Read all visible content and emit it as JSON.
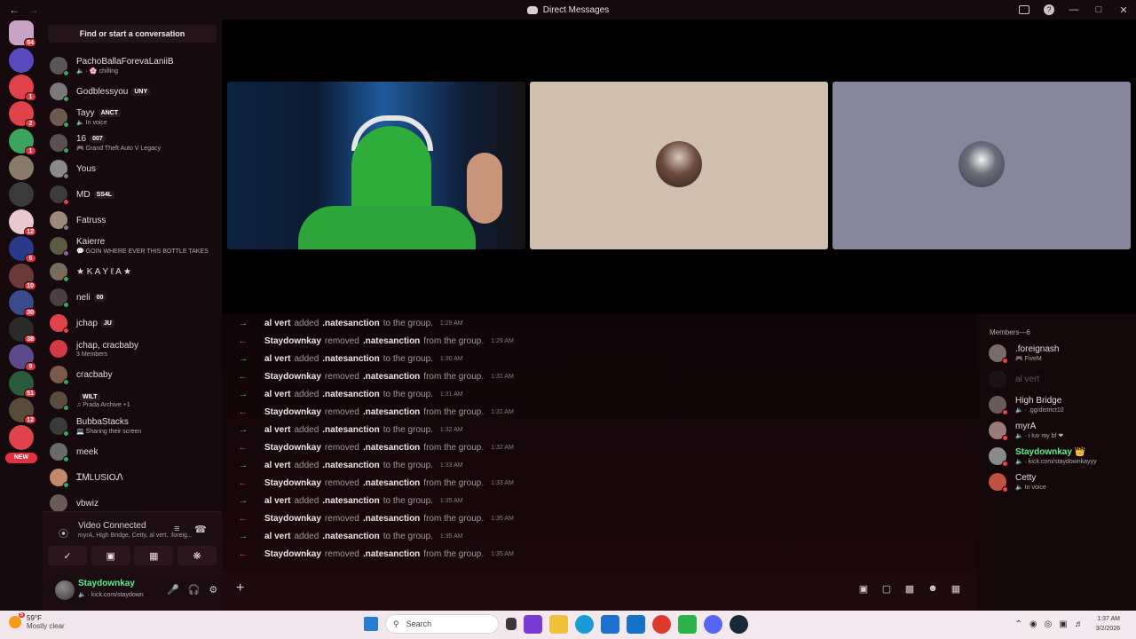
{
  "window": {
    "title": "Direct Messages"
  },
  "dm_panel": {
    "find_label": "Find or start a conversation",
    "items": [
      {
        "name": "PachoBallaForevaLaniiB",
        "sub": "🔈 · 🌸 chilling",
        "tag": "",
        "avatar": "#5b5656",
        "status": "#3ba55c"
      },
      {
        "name": "Godblessyou",
        "sub": "",
        "tag": "UNY",
        "avatar": "#7a7a7a",
        "status": "#3ba55c"
      },
      {
        "name": "Tayy",
        "sub": "🔈 In voice",
        "tag": "ANCT",
        "avatar": "#6b5a50",
        "status": "#3ba55c"
      },
      {
        "name": "16",
        "sub": "🎮 Grand Theft Auto V Legacy",
        "tag": "007",
        "avatar": "#5d5050",
        "status": "#3ba55c"
      },
      {
        "name": "Yous",
        "sub": "",
        "tag": "",
        "avatar": "#8a8a8a",
        "status": "#747f8d"
      },
      {
        "name": "MD",
        "sub": "",
        "tag": "SS4L",
        "avatar": "#3c3c3c",
        "status": "#ed4245"
      },
      {
        "name": "Fatruss",
        "sub": "",
        "tag": "",
        "avatar": "#9a8a7a",
        "status": "#747f8d"
      },
      {
        "name": "Kaierre",
        "sub": "💬 GOIN WHERE EVER THIS BOTTLE TAKES",
        "tag": "",
        "avatar": "#5c5a40",
        "status": "#9b59b6"
      },
      {
        "name": "★ K A Y ℓ A ★",
        "sub": "",
        "tag": "",
        "avatar": "#7a6a60",
        "status": "#3ba55c"
      },
      {
        "name": "neli",
        "sub": "",
        "tag": "00",
        "avatar": "#4a4040",
        "status": "#3ba55c"
      },
      {
        "name": "jchap",
        "sub": "",
        "tag": "JU",
        "avatar": "#e0424c",
        "status": "#ed4245"
      },
      {
        "name": "jchap, cracbaby",
        "sub": "3 Members",
        "tag": "",
        "avatar": "#d43a44",
        "status": ""
      },
      {
        "name": "cracbaby",
        "sub": "",
        "tag": "",
        "avatar": "#7a5a4a",
        "status": "#3ba55c"
      },
      {
        "name": "",
        "sub": "♫ Prada Archive +1",
        "tag": "WILT",
        "avatar": "#5a4a40",
        "status": "#3ba55c"
      },
      {
        "name": "BubbaStacks",
        "sub": "💻 Sharing their screen",
        "tag": "",
        "avatar": "#3a3a3a",
        "status": "#3ba55c"
      },
      {
        "name": "meek",
        "sub": "",
        "tag": "",
        "avatar": "#6a6a6a",
        "status": "#3ba55c"
      },
      {
        "name": "ᏆᎷLUSIOᏁ",
        "sub": "",
        "tag": "",
        "avatar": "#c08a6a",
        "status": "#3ba55c"
      },
      {
        "name": "vbwiz",
        "sub": "",
        "tag": "",
        "avatar": "#6a5a5a",
        "status": ""
      }
    ]
  },
  "guilds": {
    "badges": [
      "54",
      "",
      "1",
      "2",
      "1",
      "",
      "",
      "12",
      "6",
      "10",
      "30",
      "38",
      "9",
      "51",
      "12",
      ""
    ],
    "new_label": "NEW"
  },
  "voice": {
    "status": "Video Connected",
    "members": "myrA, High Bridge, Cetty, al vert, .foreig..."
  },
  "user": {
    "name": "Staydownkay",
    "status": "🔈 · kick.com/staydown"
  },
  "chat": {
    "messages": [
      {
        "dir": "in",
        "actor": "al vert",
        "verb": "added",
        "target": ".natesanction",
        "rest": "to the group.",
        "time": "1:29 AM"
      },
      {
        "dir": "out",
        "actor": "Staydownkay",
        "verb": "removed",
        "target": ".natesanction",
        "rest": "from the group.",
        "time": "1:29 AM"
      },
      {
        "dir": "in",
        "actor": "al vert",
        "verb": "added",
        "target": ".natesanction",
        "rest": "to the group.",
        "time": "1:30 AM"
      },
      {
        "dir": "out",
        "actor": "Staydownkay",
        "verb": "removed",
        "target": ".natesanction",
        "rest": "from the group.",
        "time": "1:31 AM"
      },
      {
        "dir": "in",
        "actor": "al vert",
        "verb": "added",
        "target": ".natesanction",
        "rest": "to the group.",
        "time": "1:31 AM"
      },
      {
        "dir": "out",
        "actor": "Staydownkay",
        "verb": "removed",
        "target": ".natesanction",
        "rest": "from the group.",
        "time": "1:31 AM"
      },
      {
        "dir": "in",
        "actor": "al vert",
        "verb": "added",
        "target": ".natesanction",
        "rest": "to the group.",
        "time": "1:32 AM"
      },
      {
        "dir": "out",
        "actor": "Staydownkay",
        "verb": "removed",
        "target": ".natesanction",
        "rest": "from the group.",
        "time": "1:32 AM"
      },
      {
        "dir": "in",
        "actor": "al vert",
        "verb": "added",
        "target": ".natesanction",
        "rest": "to the group.",
        "time": "1:33 AM"
      },
      {
        "dir": "out",
        "actor": "Staydownkay",
        "verb": "removed",
        "target": ".natesanction",
        "rest": "from the group.",
        "time": "1:33 AM"
      },
      {
        "dir": "in",
        "actor": "al vert",
        "verb": "added",
        "target": ".natesanction",
        "rest": "to the group.",
        "time": "1:35 AM"
      },
      {
        "dir": "out",
        "actor": "Staydownkay",
        "verb": "removed",
        "target": ".natesanction",
        "rest": "from the group.",
        "time": "1:35 AM"
      },
      {
        "dir": "in",
        "actor": "al vert",
        "verb": "added",
        "target": ".natesanction",
        "rest": "to the group.",
        "time": "1:35 AM"
      },
      {
        "dir": "out",
        "actor": "Staydownkay",
        "verb": "removed",
        "target": ".natesanction",
        "rest": "from the group.",
        "time": "1:35 AM"
      }
    ]
  },
  "members": {
    "header": "Members—6",
    "list": [
      {
        "name": ".foreignash",
        "sub": "🎮 FiveM",
        "color": "#e6dbde",
        "avatar": "#7a6a6a",
        "status": "#ed4245",
        "offline": false
      },
      {
        "name": "al vert",
        "sub": "",
        "color": "#e6dbde",
        "avatar": "#2a2a2a",
        "status": "",
        "offline": true
      },
      {
        "name": "High Bridge",
        "sub": "🔈 · .gg/district10",
        "color": "#e6dbde",
        "avatar": "#6a5a5a",
        "status": "#ed4245",
        "offline": false
      },
      {
        "name": "myrA",
        "sub": "🔈 · i luv my bf ❤",
        "color": "#e6dbde",
        "avatar": "#9a7a7a",
        "status": "#ed4245",
        "offline": false
      },
      {
        "name": "Staydownkay 👑",
        "sub": "🔈 · kick.com/staydownkayyy",
        "color": "#5cf08e",
        "avatar": "#8a8a8a",
        "status": "#ed4245",
        "offline": false
      },
      {
        "name": "Cetty",
        "sub": "🔈 In voice",
        "color": "#e6dbde",
        "avatar": "#c05040",
        "status": "#ed4245",
        "offline": false
      }
    ]
  },
  "taskbar": {
    "temp": "59°F",
    "weather": "Mostly clear",
    "search": "Search",
    "time": "1:37 AM",
    "date": "3/2/2026"
  },
  "colors": {
    "accent_red": "#e0333f",
    "online": "#3ba55c",
    "self_name": "#5cf08e"
  }
}
